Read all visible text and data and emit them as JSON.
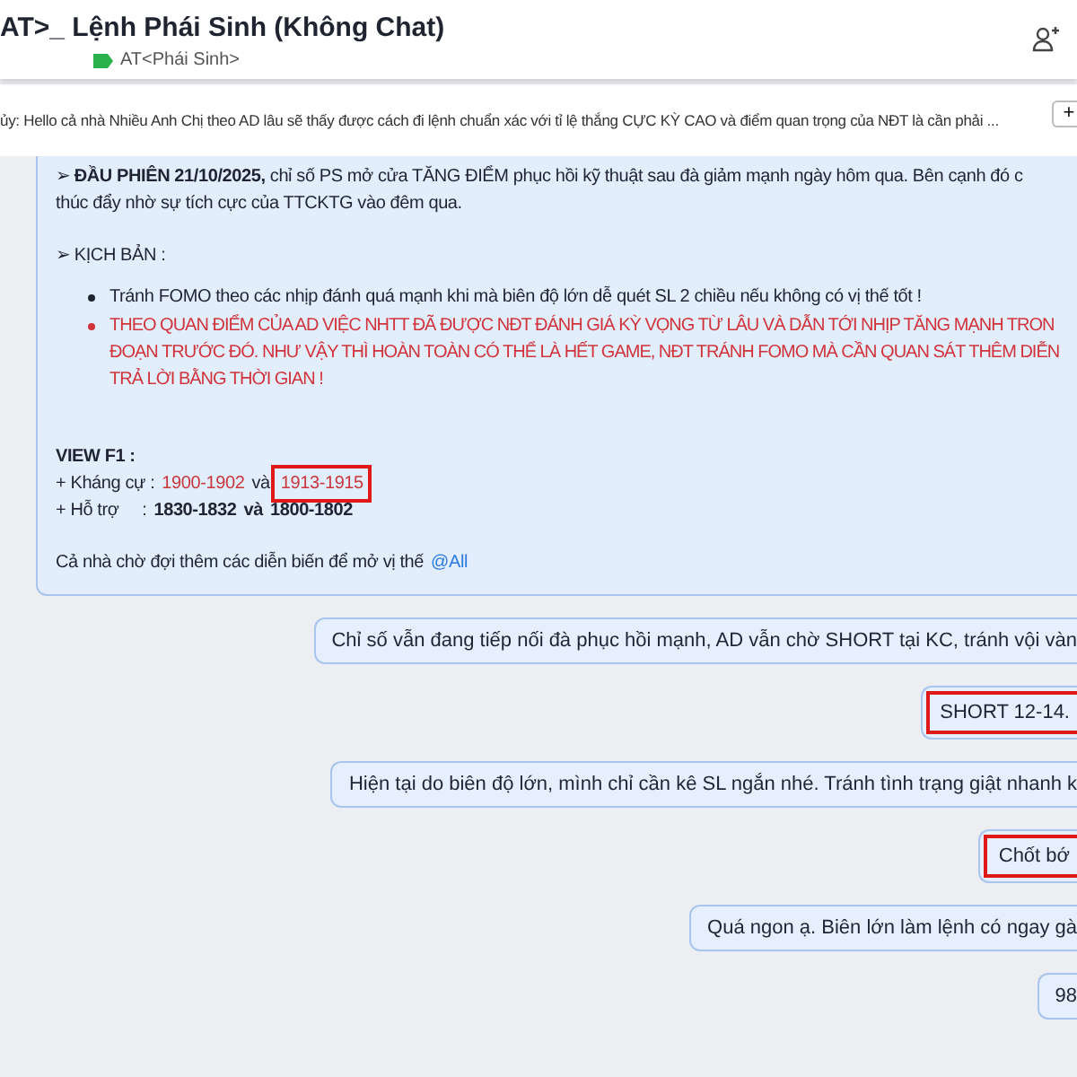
{
  "header": {
    "title": "AT>_ Lệnh Phái Sinh (Không Chat)",
    "tag": "AT<Phái Sinh>"
  },
  "pinned": {
    "text": "ủy: Hello cả nhà Nhiều Anh Chị theo AD lâu sẽ thấy được cách đi lệnh chuẩn xác với tỉ lệ thắng CỰC KỲ CAO và điểm quan trọng của NĐT là cần phải ...",
    "button": "+"
  },
  "post": {
    "lead": [
      "➢ **ĐẦU PHIÊN 21/10/2025,** chỉ số PS mở cửa TĂNG ĐIỂM phục hồi kỹ thuật sau đà giảm mạnh ngày hôm qua. Bên cạnh đó c",
      "thúc đẩy nhờ sự tích cực của TTCKTG vào đêm qua."
    ],
    "scenario_title": "➢ KỊCH BẢN :",
    "bullets": [
      {
        "kind": "normal",
        "lines": [
          "Tránh FOMO theo các nhịp đánh quá mạnh khi mà biên độ lớn dễ quét SL 2 chiều nếu không có vị thế tốt !"
        ]
      },
      {
        "kind": "alert",
        "lines": [
          "THEO QUAN ĐIỂM CỦA AD VIỆC NHTT ĐÃ ĐƯỢC NĐT ĐÁNH GIÁ KỲ VỌNG TỪ LÂU VÀ DẪN TỚI NHỊP TĂNG MẠNH TRON",
          "ĐOẠN TRƯỚC ĐÓ. NHƯ VẬY THÌ HOÀN TOÀN CÓ THỂ LÀ HẾT GAME, NĐT TRÁNH FOMO MÀ CẦN QUAN SÁT THÊM DIỄN",
          "TRẢ LỜI BẰNG THỜI GIAN !"
        ]
      }
    ],
    "view_title": "VIEW F1 :",
    "levels": [
      {
        "kind": "resistance",
        "label": "+ Kháng cự :",
        "first": {
          "text": "1900-1902",
          "highlighted": false
        },
        "joiner": "và",
        "second": {
          "text": "1913-1915",
          "highlighted": true
        }
      },
      {
        "kind": "support",
        "label": "+ Hỗ trợ     :",
        "first": {
          "text": "1830-1832",
          "highlighted": false
        },
        "joiner": "và",
        "second": {
          "text": "1800-1802",
          "highlighted": false
        }
      }
    ],
    "closing": "Cả nhà chờ đợi thêm các diễn biến để mở vị thế",
    "mention": "@All"
  },
  "messages": [
    {
      "text": "Chỉ số vẫn đang tiếp nối đà phục hồi mạnh, AD vẫn chờ SHORT tại KC, tránh vội vàn",
      "highlighted": false
    },
    {
      "text": "SHORT 12-14.",
      "highlighted": true
    },
    {
      "text": "Hiện tại do biên độ lớn, mình chỉ cần kê SL ngắn nhé. Tránh tình trạng giật nhanh k",
      "highlighted": false
    },
    {
      "text": "Chốt bớ",
      "highlighted": true
    },
    {
      "text": "Quá ngon ạ. Biên lớn làm lệnh có ngay gà",
      "highlighted": false
    },
    {
      "text": "98",
      "highlighted": false
    }
  ]
}
